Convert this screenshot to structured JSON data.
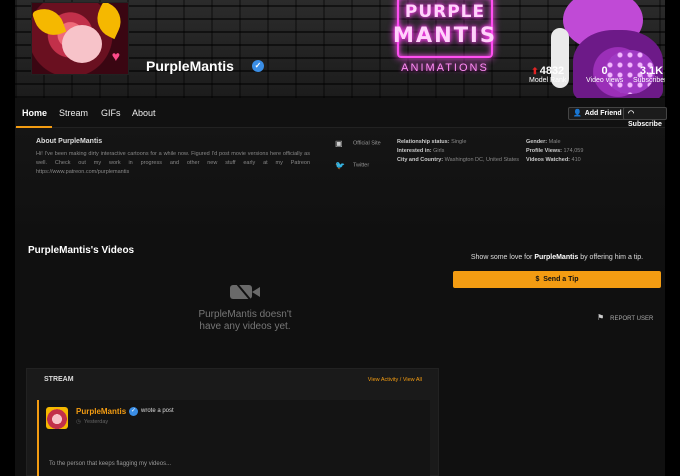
{
  "profile": {
    "username": "PurpleMantis",
    "verified_icon": "check-icon"
  },
  "banner": {
    "neon_line1": "PURPLE",
    "neon_line2": "MANTIS",
    "neon_line3": "ANIMATIONS",
    "stats": [
      {
        "value": "4832",
        "label": "Model Rank"
      },
      {
        "value": "0",
        "label": "Video views"
      },
      {
        "value": "3.1K",
        "label": "Subscribers"
      }
    ]
  },
  "nav": {
    "tabs": [
      {
        "label": "Home"
      },
      {
        "label": "Stream"
      },
      {
        "label": "GIFs"
      },
      {
        "label": "About"
      }
    ],
    "add_friend": "Add Friend",
    "subscribe": "Subscribe"
  },
  "about": {
    "title": "About PurpleMantis",
    "text": "Hi! I've been making dirty interactive cartoons for a while now. Figured I'd post movie versions here officially as well. Check out my work in progress and other new stuff early at my Patreon https://www.patreon.com/purplemantis",
    "links": [
      {
        "label": "Official Site",
        "icon": "globe-icon"
      },
      {
        "label": "Twitter",
        "icon": "twitter-icon"
      }
    ],
    "details_left": [
      {
        "key": "Relationship status:",
        "value": "Single"
      },
      {
        "key": "Interested in:",
        "value": "Girls"
      },
      {
        "key": "City and Country:",
        "value": "Washington DC, United States"
      }
    ],
    "details_right": [
      {
        "key": "Gender:",
        "value": "Male"
      },
      {
        "key": "Profile Views:",
        "value": "174,059"
      },
      {
        "key": "Videos Watched:",
        "value": "410"
      }
    ]
  },
  "videos": {
    "title": "PurpleMantis's Videos",
    "empty_line1": "PurpleMantis doesn't",
    "empty_line2": "have any videos yet."
  },
  "tip": {
    "prefix": "Show some love for",
    "name": "PurpleMantis",
    "suffix": "by offering him a tip.",
    "button": "Send a Tip",
    "report": "REPORT USER"
  },
  "stream": {
    "title": "STREAM",
    "links": "View Activity / View All",
    "post": {
      "author": "PurpleMantis",
      "action": "wrote a post",
      "time": "Yesterday",
      "body": "To the person that keeps flagging my videos..."
    }
  },
  "colors": {
    "accent": "#f39c12",
    "verified": "#3a8ee6",
    "neon": "#ff4ff2"
  }
}
